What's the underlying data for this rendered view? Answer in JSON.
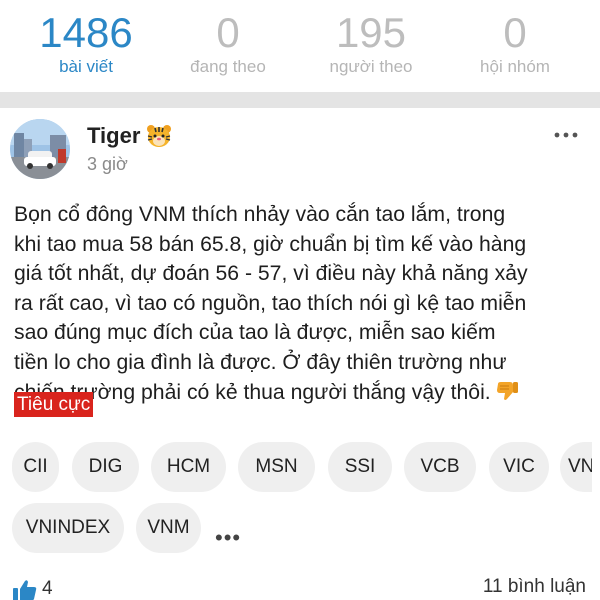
{
  "stats": [
    {
      "value": "1486",
      "label": "bài viết",
      "active": true
    },
    {
      "value": "0",
      "label": "đang theo",
      "active": false
    },
    {
      "value": "195",
      "label": "người theo",
      "active": false
    },
    {
      "value": "0",
      "label": "hội nhóm",
      "active": false
    }
  ],
  "post": {
    "author": "Tiger",
    "author_badge_icon": "tiger-face-icon",
    "time": "3 giờ",
    "more_icon": "more-horizontal-icon",
    "body_lines": [
      "Bọn cổ đông VNM thích nhảy vào cắn tao lắm, trong",
      "khi tao mua 58 bán 65.8, giờ chuẩn bị tìm kế vào hàng",
      "giá tốt nhất, dự đoán 56 - 57, vì điều này khả năng xảy",
      "ra rất cao, vì tao có nguồn, tao thích nói gì kệ tao miễn",
      "sao đúng mục đích của tao là được, miễn sao kiếm",
      "tiền lo cho gia đình là được. Ở đây thiên trường như",
      "chiến trường phải có kẻ thua người thắng vậy thôi."
    ],
    "body_end_icon": "thumbs-down-emoji-icon",
    "sentiment_label": "Tiêu cực",
    "sentiment_color": "#d9241d",
    "tags": [
      "CII",
      "DIG",
      "HCM",
      "MSN",
      "SSI",
      "VCB",
      "VIC",
      "VND",
      "VNINDEX",
      "VNM"
    ],
    "tags_more": "•••",
    "likes": "4",
    "comments": "11 bình luận"
  },
  "colors": {
    "accent": "#2b87c6",
    "inactive": "#bdbdbd",
    "divider": "#e4e4e4",
    "tag_bg": "#efefef"
  }
}
